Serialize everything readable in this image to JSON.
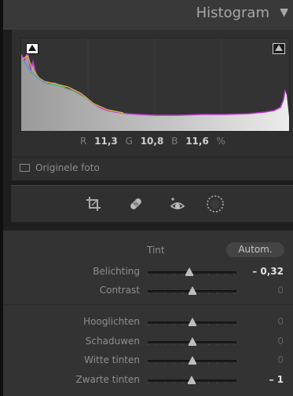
{
  "header": {
    "title": "Histogram",
    "collapse_icon": "triangle-down-icon"
  },
  "histogram": {
    "readout": {
      "r_label": "R",
      "r_value": "11,3",
      "g_label": "G",
      "g_value": "10,8",
      "b_label": "B",
      "b_value": "11,6",
      "unit": "%"
    },
    "original_photo_label": "Originele foto"
  },
  "tools": [
    {
      "icon": "crop-icon"
    },
    {
      "icon": "healing-bandage-icon"
    },
    {
      "icon": "red-eye-icon"
    },
    {
      "icon": "radial-mask-icon"
    }
  ],
  "basic": {
    "tint_label": "Tint",
    "auto_label": "Autom.",
    "sliders": [
      {
        "label": "Belichting",
        "value": "– 0,32",
        "active": true,
        "level": -0.32,
        "min": -5,
        "max": 5
      },
      {
        "label": "Contrast",
        "value": "0",
        "active": false,
        "level": 0,
        "min": -100,
        "max": 100
      },
      {
        "label": "Hooglichten",
        "value": "0",
        "active": false,
        "level": 0,
        "min": -100,
        "max": 100
      },
      {
        "label": "Schaduwen",
        "value": "0",
        "active": false,
        "level": 0,
        "min": -100,
        "max": 100
      },
      {
        "label": "Witte tinten",
        "value": "0",
        "active": false,
        "level": 0,
        "min": -100,
        "max": 100
      },
      {
        "label": "Zwarte tinten",
        "value": "– 1",
        "active": true,
        "level": -1,
        "min": -100,
        "max": 100
      }
    ]
  }
}
